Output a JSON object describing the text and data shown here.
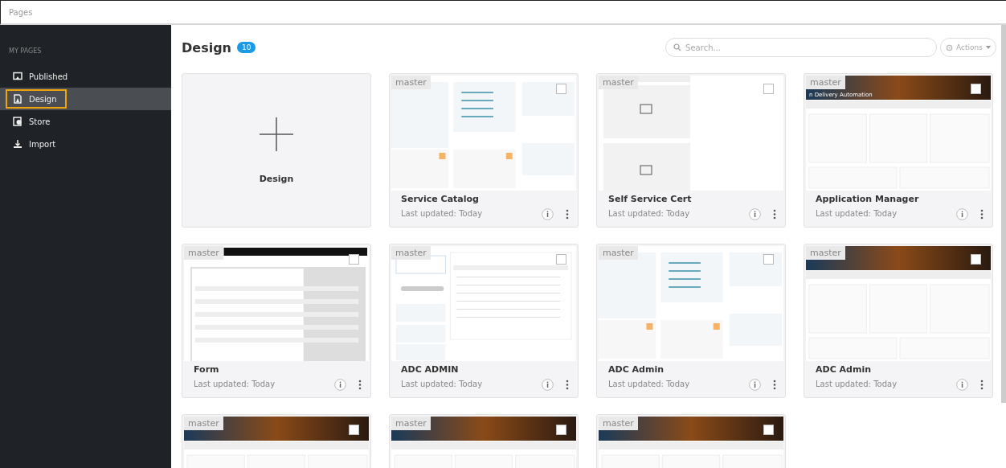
{
  "window": {
    "title": "Pages"
  },
  "sidebar": {
    "heading": "MY PAGES",
    "items": [
      {
        "label": "Published",
        "selected": false
      },
      {
        "label": "Design",
        "selected": true
      },
      {
        "label": "Store",
        "selected": false
      },
      {
        "label": "Import",
        "selected": false
      }
    ]
  },
  "header": {
    "title": "Design",
    "count": "10",
    "search": {
      "placeholder": "Search..."
    },
    "actions": "Actions"
  },
  "cards": [
    {
      "kind": "new",
      "title": "Design"
    },
    {
      "kind": "dashboard",
      "tag": "master",
      "title": "Service Catalog",
      "subtitle": "Last updated: Today",
      "selected": false
    },
    {
      "kind": "map",
      "tag": "master",
      "title": "Self Service Cert",
      "subtitle": "Last updated: Today",
      "selected": false
    },
    {
      "kind": "banner",
      "tag": "master",
      "banner_text": "n Delivery Automation",
      "title": "Application Manager",
      "subtitle": "Last updated: Today",
      "selected": false
    },
    {
      "kind": "form",
      "tag": "master",
      "title": "Form",
      "subtitle": "Last updated: Today",
      "selected": false
    },
    {
      "kind": "table",
      "tag": "master",
      "title": "ADC ADMIN",
      "subtitle": "Last updated: Today",
      "selected": false
    },
    {
      "kind": "dashboard",
      "tag": "master",
      "title": "ADC Admin",
      "subtitle": "Last updated: Today",
      "selected": false
    },
    {
      "kind": "banner",
      "tag": "master",
      "title": "ADC Admin",
      "subtitle": "Last updated: Today",
      "selected": false
    },
    {
      "kind": "banner",
      "tag": "master",
      "selected": false
    },
    {
      "kind": "banner",
      "tag": "master",
      "selected": false
    },
    {
      "kind": "banner",
      "tag": "master",
      "selected": false
    }
  ]
}
